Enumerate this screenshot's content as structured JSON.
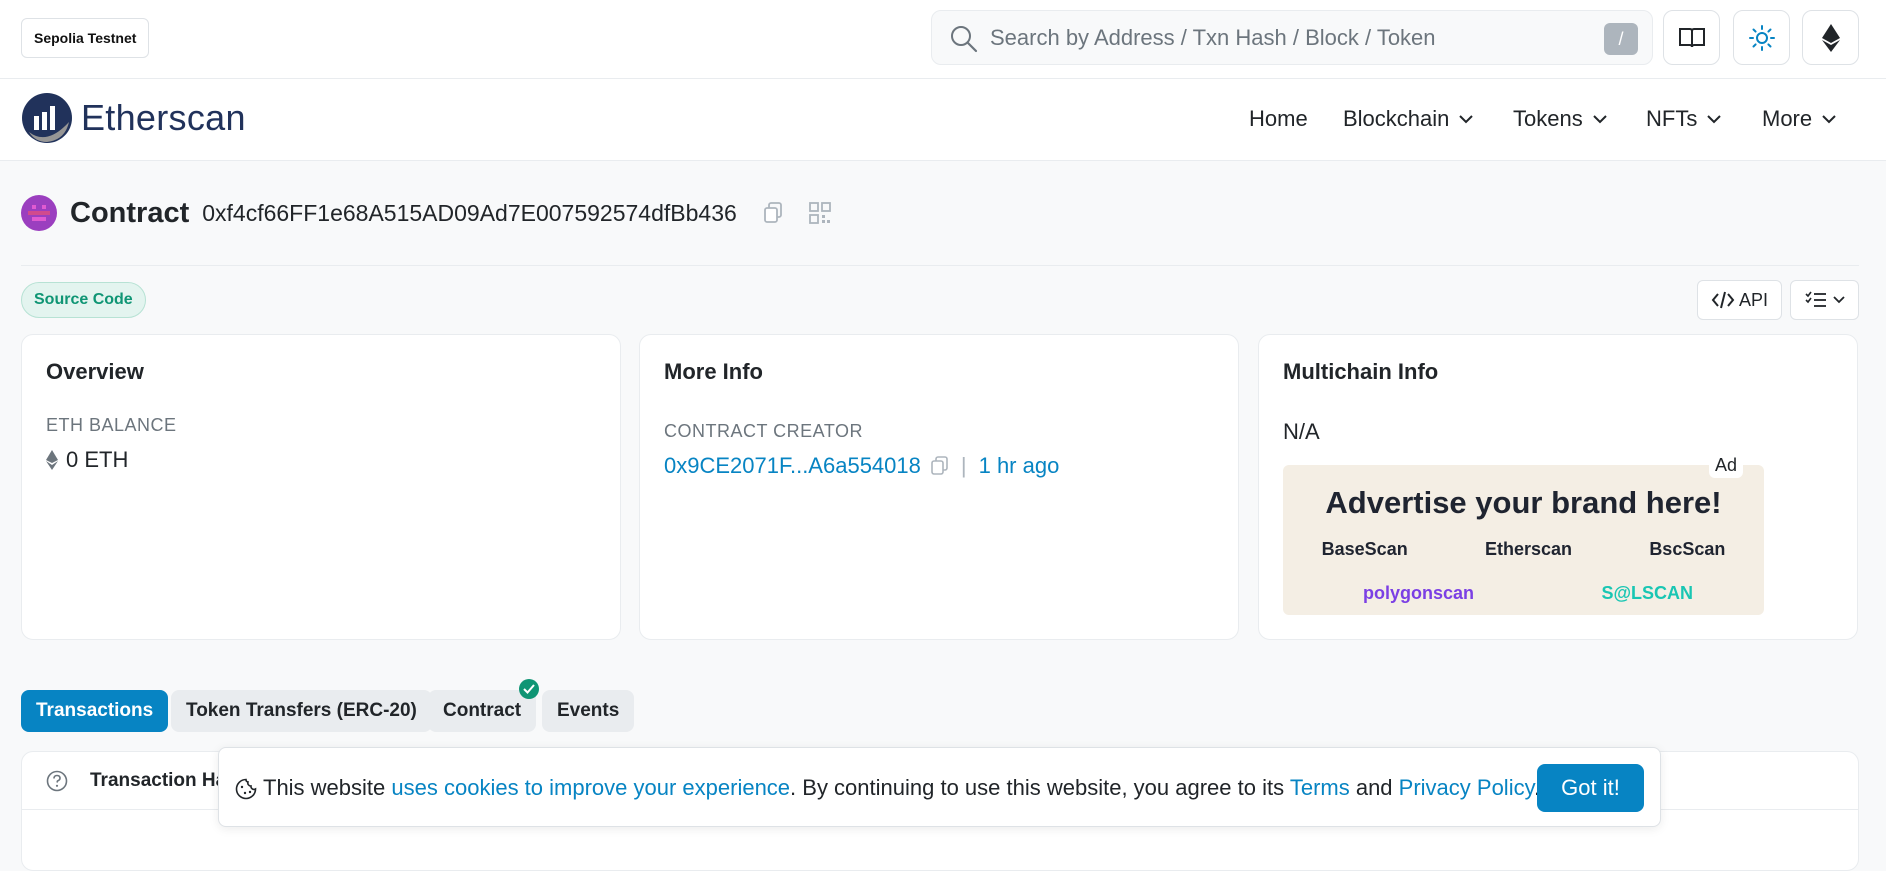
{
  "network": {
    "label": "Sepolia Testnet"
  },
  "search": {
    "placeholder": "Search by Address / Txn Hash / Block / Token",
    "shortcut": "/"
  },
  "brand": {
    "name": "Etherscan"
  },
  "nav": {
    "home": "Home",
    "blockchain": "Blockchain",
    "tokens": "Tokens",
    "nfts": "NFTs",
    "more": "More"
  },
  "contract": {
    "label": "Contract",
    "address": "0xf4cf66FF1e68A515AD09Ad7E007592574dfBb436"
  },
  "source_badge": "Source Code",
  "api_label": "API",
  "overview": {
    "title": "Overview",
    "balance_label": "ETH BALANCE",
    "balance_value": "0 ETH"
  },
  "more_info": {
    "title": "More Info",
    "creator_label": "CONTRACT CREATOR",
    "creator_address": "0x9CE2071F...A6a554018",
    "creator_time": "1 hr ago"
  },
  "multichain": {
    "title": "Multichain Info",
    "value": "N/A",
    "ad_tag": "Ad",
    "ad_title": "Advertise your brand here!",
    "ad_brands": [
      "BaseScan",
      "Etherscan",
      "BscScan"
    ],
    "ad_brands2": [
      "polygonscan",
      "S@LSCAN"
    ]
  },
  "tabs": {
    "transactions": "Transactions",
    "token_transfers": "Token Transfers (ERC-20)",
    "contract": "Contract",
    "events": "Events"
  },
  "table": {
    "header_label": "Transaction Ha"
  },
  "cookie": {
    "prefix": "This website ",
    "link1": "uses cookies to improve your experience",
    "middle": ". By continuing to use this website, you agree to its ",
    "terms": "Terms",
    "and": " and ",
    "privacy": "Privacy Policy",
    "suffix": ".",
    "button": "Got it!"
  },
  "colors": {
    "accent": "#0784c3",
    "success": "#0f9574",
    "navy": "#21325b"
  }
}
